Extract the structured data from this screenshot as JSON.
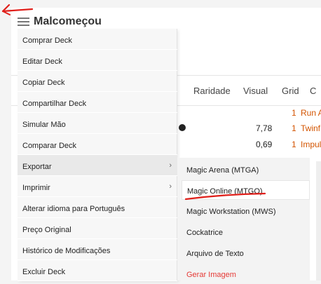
{
  "header": {
    "title": "Malcomeçou"
  },
  "table": {
    "columns": [
      "Raridade",
      "Visual",
      "Grid",
      "C"
    ],
    "rows": [
      {
        "price": "",
        "qty": "1",
        "name": "Run A"
      },
      {
        "price": "7,78",
        "qty": "1",
        "name": "Twinf"
      },
      {
        "price": "0,69",
        "qty": "1",
        "name": "Impul"
      }
    ]
  },
  "menu": {
    "items": [
      "Comprar Deck",
      "Editar Deck",
      "Copiar Deck",
      "Compartilhar Deck",
      "Simular Mão",
      "Comparar Deck",
      "Exportar",
      "Imprimir",
      "Alterar idioma para Português",
      "Preço Original",
      "Histórico de Modificações",
      "Excluir Deck"
    ],
    "submenu_indicator": "›"
  },
  "submenu": {
    "items": [
      "Magic Arena (MTGA)",
      "Magic Online (MTGO)",
      "Magic Workstation (MWS)",
      "Cockatrice",
      "Arquivo de Texto",
      "Gerar Imagem"
    ]
  },
  "colors": {
    "accent": "#d35400",
    "danger": "#e53935",
    "annotation": "#e0201b"
  },
  "icons": {
    "menu": "hamburger-icon",
    "chevron": "chevron-right-icon"
  }
}
